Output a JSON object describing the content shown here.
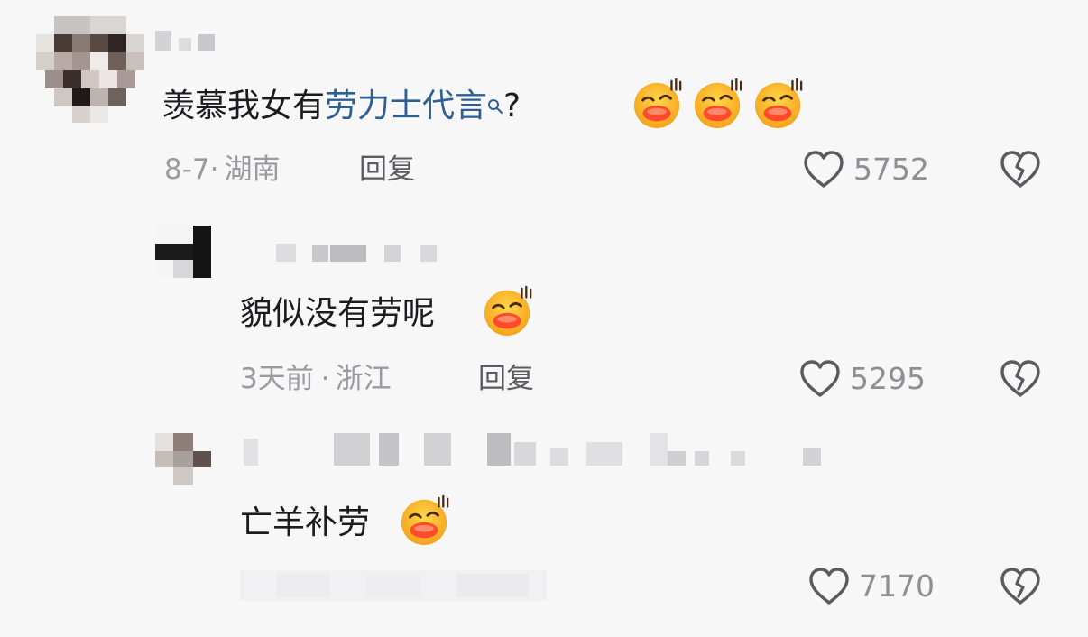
{
  "comments": [
    {
      "text_plain": "羡慕我女有",
      "text_link": "劳力士代言",
      "text_suffix": "?",
      "emoji_count": 3,
      "date": "8-7",
      "sep": "·",
      "location": "湖南",
      "reply_label": "回复",
      "likes": "5752"
    },
    {
      "text_plain": "貌似没有劳呢",
      "emoji_count": 1,
      "date": "3天前",
      "sep": "·",
      "location": "浙江",
      "reply_label": "回复",
      "likes": "5295"
    },
    {
      "text_plain": "亡羊补劳",
      "emoji_count": 1,
      "likes": "7170"
    }
  ],
  "icons": {
    "search": "search-icon",
    "like": "heart-icon",
    "dislike": "broken-heart-icon",
    "emoji": "grinning-face-emoji"
  },
  "colors": {
    "background": "#f7f7f8",
    "text": "#1c1c1e",
    "link": "#2e5f93",
    "meta": "#9a9a9f",
    "emoji": "#f5a623"
  }
}
